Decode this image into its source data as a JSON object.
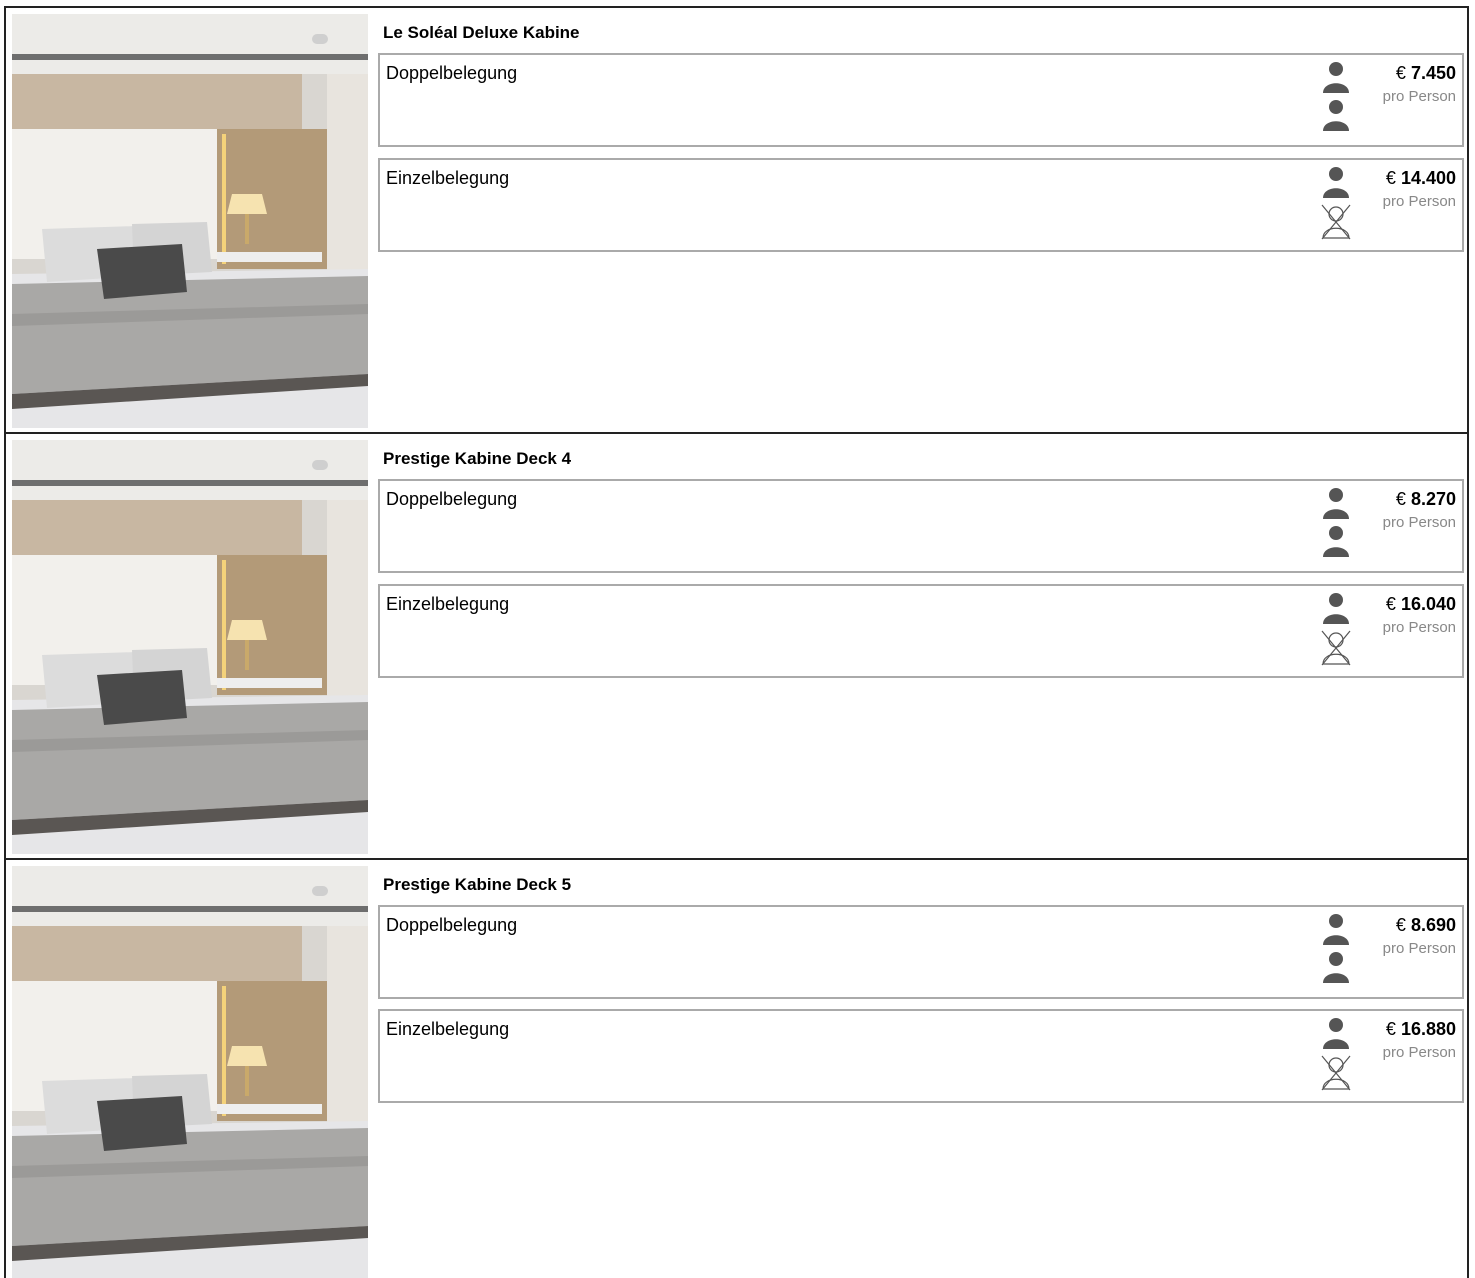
{
  "colors": {
    "person_icon": "#555555",
    "frame_border": "#222222",
    "row_border": "#aaaaaa",
    "muted_text": "#888888"
  },
  "cabins": [
    {
      "title": "Le Soléal Deluxe Kabine",
      "image_icon": "cabin-photo",
      "options": [
        {
          "label": "Doppelbelegung",
          "icon": "two-persons-icon",
          "currency": "€",
          "price": "7.450",
          "unit": "pro Person"
        },
        {
          "label": "Einzelbelegung",
          "icon": "single-person-icon",
          "currency": "€",
          "price": "14.400",
          "unit": "pro Person"
        }
      ]
    },
    {
      "title": "Prestige Kabine Deck 4",
      "image_icon": "cabin-photo",
      "options": [
        {
          "label": "Doppelbelegung",
          "icon": "two-persons-icon",
          "currency": "€",
          "price": "8.270",
          "unit": "pro Person"
        },
        {
          "label": "Einzelbelegung",
          "icon": "single-person-icon",
          "currency": "€",
          "price": "16.040",
          "unit": "pro Person"
        }
      ]
    },
    {
      "title": "Prestige Kabine Deck 5",
      "image_icon": "cabin-photo",
      "options": [
        {
          "label": "Doppelbelegung",
          "icon": "two-persons-icon",
          "currency": "€",
          "price": "8.690",
          "unit": "pro Person"
        },
        {
          "label": "Einzelbelegung",
          "icon": "single-person-icon",
          "currency": "€",
          "price": "16.880",
          "unit": "pro Person"
        }
      ]
    }
  ]
}
